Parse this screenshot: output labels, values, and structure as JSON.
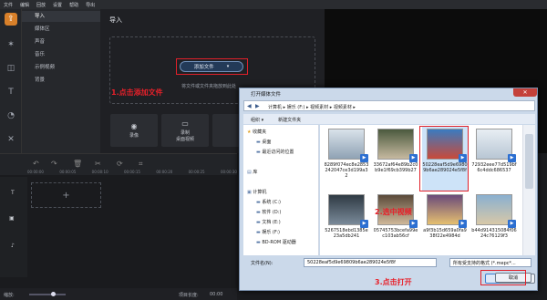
{
  "menubar": {
    "items": [
      "文件",
      "编辑",
      "回放",
      "设置",
      "帮助",
      "导出"
    ]
  },
  "nav": {
    "items": [
      "导入",
      "媒体区",
      "声音",
      "音乐",
      "示例视频",
      "背景"
    ],
    "selected": 0
  },
  "import_pane": {
    "title": "导入",
    "add_button": "添加文件",
    "hint": "将文件或文件夹拖放到此处",
    "tiles": [
      "录像",
      "录制\n桌面视频",
      ""
    ]
  },
  "annotations": {
    "step1": "1.点击添加文件",
    "step2": "2.选中视频",
    "step3": "3.点击打开"
  },
  "timeline": {
    "ruler": [
      "00:00:00",
      "00:00:05",
      "00:00:10",
      "00:00:15",
      "00:00:20",
      "00:00:25",
      "00:00:30"
    ],
    "add_symbol": "+",
    "zoom_label": "缩放:",
    "duration_label": "项目长度:",
    "duration_value": "00:00"
  },
  "dialog": {
    "title": "打开媒体文件",
    "close": "✕",
    "breadcrumb": [
      "计算机",
      "娱乐 (F:)",
      "视频素材",
      "视频素材"
    ],
    "toolbar": [
      "组织 ▾",
      "新建文件夹"
    ],
    "tree": [
      {
        "label": "收藏夹",
        "icon": "star-icon"
      },
      {
        "label": "桌面",
        "icon": "desktop-icon"
      },
      {
        "label": "最近访问的位置",
        "icon": "recent-icon"
      },
      {
        "label": "",
        "icon": ""
      },
      {
        "label": "库",
        "icon": "library-icon"
      },
      {
        "label": "",
        "icon": ""
      },
      {
        "label": "计算机",
        "icon": "computer-icon"
      },
      {
        "label": "系统 (C:)",
        "icon": "drive-icon"
      },
      {
        "label": "软件 (D:)",
        "icon": "drive-icon"
      },
      {
        "label": "文档 (E:)",
        "icon": "drive-icon"
      },
      {
        "label": "娱乐 (F:)",
        "icon": "drive-icon"
      },
      {
        "label": "BD-ROM 驱动器",
        "icon": "disc-icon"
      }
    ],
    "files": [
      {
        "name": "8289f074ec8e2853242047ce3d199a32",
        "c1": "#d9e2ea",
        "c2": "#8fa2b4"
      },
      {
        "name": "33672af64e89b2c0b9e1f69cb399b27",
        "c1": "#4b5a3e",
        "c2": "#c6b9a0"
      },
      {
        "name": "50228eaf5d9e69809b6ae289024e5f8f",
        "c1": "#3a7bc0",
        "c2": "#c84a3a"
      },
      {
        "name": "72932eee77d519bf6c4ddc686537",
        "c1": "#e8eef4",
        "c2": "#b8c6d4"
      },
      {
        "name": "5267518ebd1385e23a5db241",
        "c1": "#2f3a44",
        "c2": "#7a8a99"
      },
      {
        "name": "05745753bcefa99ec103ab56cf",
        "c1": "#5a4a3a",
        "c2": "#cfb89a"
      },
      {
        "name": "a9f3b15d659a0fa938f22e4984d",
        "c1": "#6a4a7a",
        "c2": "#e6c070"
      },
      {
        "name": "b44d914315084f0624c76129f3",
        "c1": "#8ab0d0",
        "c2": "#d8c8a8"
      }
    ],
    "filename_label": "文件名(N):",
    "filename_value": "50228eaf5d9e69809b6ae289024e5f8f",
    "filter_value": "所有受支持的格式 (*.mepc*...",
    "open_button": "打开(O)",
    "cancel_button": "取消"
  }
}
